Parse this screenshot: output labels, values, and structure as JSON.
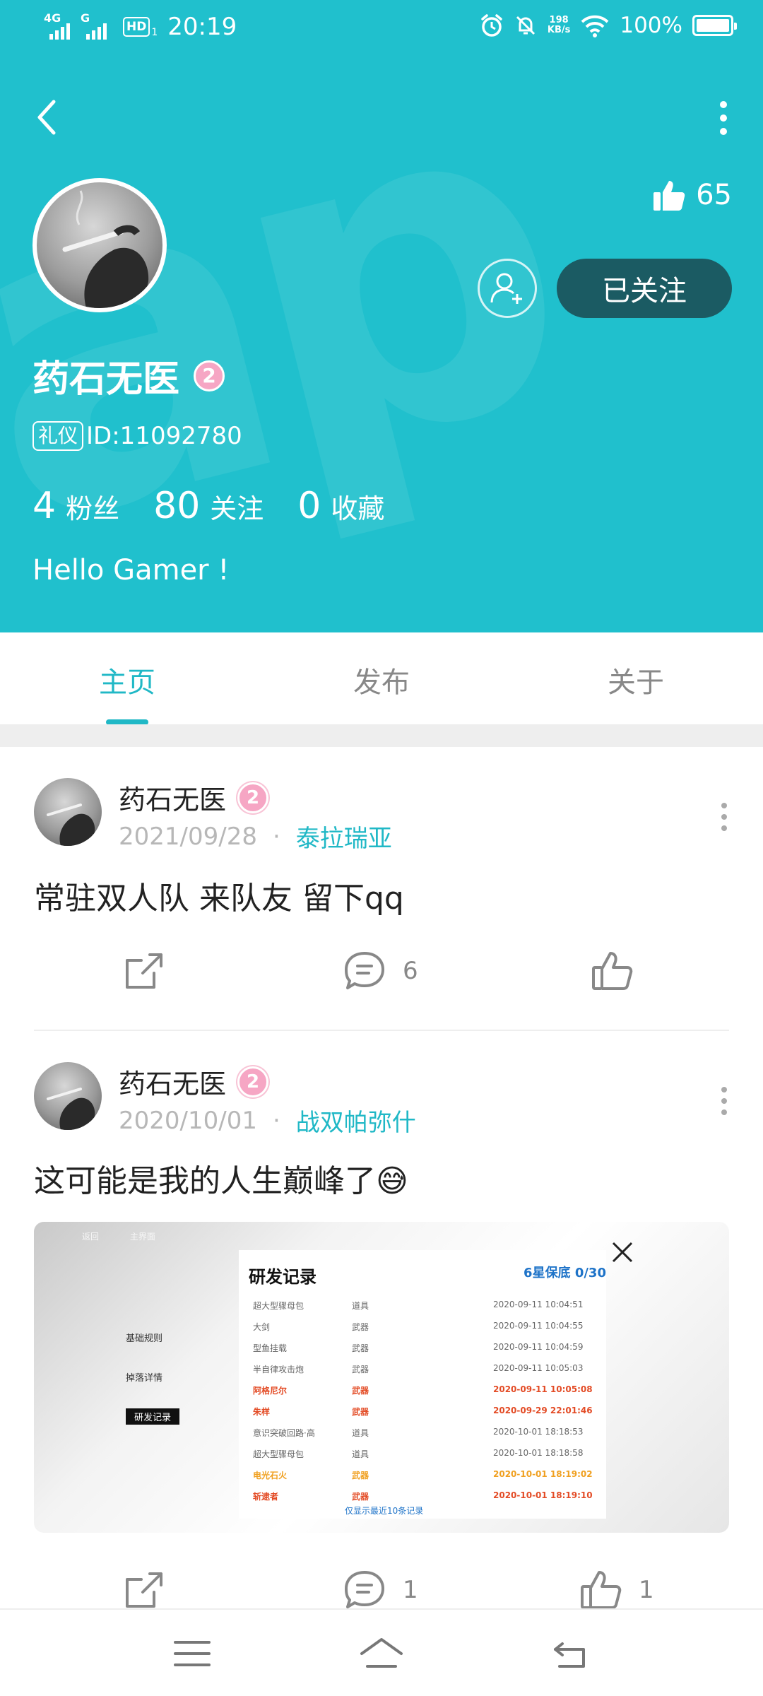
{
  "status_bar": {
    "signal1_tag": "4G",
    "signal2_tag": "G",
    "hd_label": "HD",
    "hd_sub": "1",
    "time": "20:19",
    "net_speed_value": "198",
    "net_speed_unit": "KB/s",
    "battery_pct": "100%"
  },
  "profile": {
    "like_count": "65",
    "follow_label": "已关注",
    "name": "药石无医",
    "level": "2",
    "id_tag": "礼仪",
    "id_text": "ID:11092780",
    "stats": [
      {
        "num": "4",
        "label": "粉丝"
      },
      {
        "num": "80",
        "label": "关注"
      },
      {
        "num": "0",
        "label": "收藏"
      }
    ],
    "bio": "Hello Gamer !"
  },
  "tabs": [
    {
      "label": "主页"
    },
    {
      "label": "发布"
    },
    {
      "label": "关于"
    }
  ],
  "posts": [
    {
      "author": "药石无医",
      "level": "2",
      "date": "2021/09/28",
      "dot": "·",
      "game": "泰拉瑞亚",
      "text": "常驻双人队 来队友 留下qq",
      "comments": "6",
      "likes": ""
    },
    {
      "author": "药石无医",
      "level": "2",
      "date": "2020/10/01",
      "dot": "·",
      "game": "战双帕弥什",
      "text": "这可能是我的人生巅峰了😅",
      "comments": "1",
      "likes": "1",
      "image": {
        "top_back": "返回",
        "top_home": "主界面",
        "title": "研发记录",
        "guarantee": "6星保底 0/30",
        "menu": [
          "基础规则",
          "掉落详情",
          "研发记录"
        ],
        "rows": [
          {
            "name": "超大型骤母包",
            "type": "道具",
            "time": "2020-09-11 10:04:51",
            "style": "normal"
          },
          {
            "name": "大剑",
            "type": "武器",
            "time": "2020-09-11 10:04:55",
            "style": "normal"
          },
          {
            "name": "型鱼挂载",
            "type": "武器",
            "time": "2020-09-11 10:04:59",
            "style": "normal"
          },
          {
            "name": "半自律攻击炮",
            "type": "武器",
            "time": "2020-09-11 10:05:03",
            "style": "normal"
          },
          {
            "name": "阿格尼尔",
            "type": "武器",
            "time": "2020-09-11 10:05:08",
            "style": "hl"
          },
          {
            "name": "朱样",
            "type": "武器",
            "time": "2020-09-29 22:01:46",
            "style": "hl"
          },
          {
            "name": "意识突破回路·高",
            "type": "道具",
            "time": "2020-10-01 18:18:53",
            "style": "normal"
          },
          {
            "name": "超大型骤母包",
            "type": "道具",
            "time": "2020-10-01 18:18:58",
            "style": "normal"
          },
          {
            "name": "电光石火",
            "type": "武器",
            "time": "2020-10-01 18:19:02",
            "style": "gold"
          },
          {
            "name": "斩逮者",
            "type": "武器",
            "time": "2020-10-01 18:19:10",
            "style": "hl"
          }
        ],
        "footer": "仅显示最近10条记录"
      }
    }
  ],
  "colors": {
    "header_bg": "#20c0cd",
    "accent": "#20b8c6",
    "follow_btn": "#1b5b63",
    "level_badge": "#f6a6c4"
  },
  "icons": {
    "back": "chevron-left-icon",
    "more": "more-vertical-icon",
    "like": "thumbs-up-icon",
    "add_friend": "user-plus-icon",
    "share": "share-icon",
    "comment": "comment-icon",
    "menu": "menu-icon",
    "home": "home-icon",
    "return": "return-icon"
  }
}
